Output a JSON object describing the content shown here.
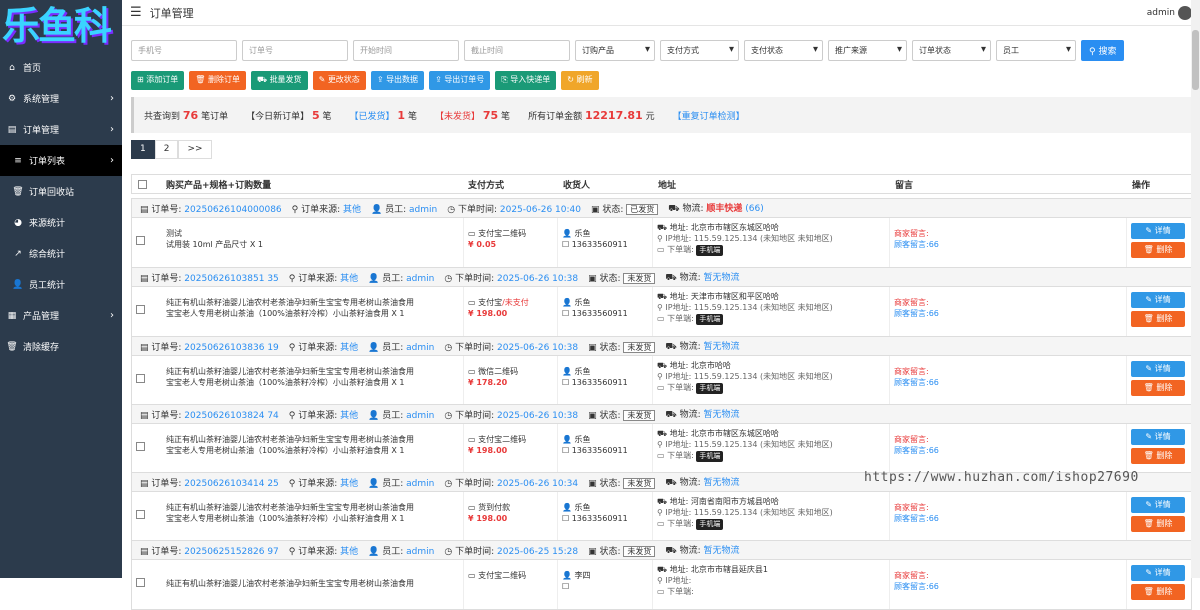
{
  "brand": {
    "logo_text": "乐鱼科"
  },
  "topbar": {
    "title": "订单管理",
    "user": "admin"
  },
  "sidebar": {
    "items": [
      {
        "label": "首页",
        "icon": "home-icon",
        "glyph": "⌂"
      },
      {
        "label": "系统管理",
        "icon": "gear-icon",
        "glyph": "⚙"
      },
      {
        "label": "订单管理",
        "icon": "table-icon",
        "glyph": "▤"
      },
      {
        "label": "订单列表",
        "icon": "list-icon",
        "glyph": "≡"
      },
      {
        "label": "订单回收站",
        "icon": "trash-icon",
        "glyph": "🗑"
      },
      {
        "label": "来源统计",
        "icon": "pie-icon",
        "glyph": "◕"
      },
      {
        "label": "综合统计",
        "icon": "line-chart-icon",
        "glyph": "↗"
      },
      {
        "label": "员工统计",
        "icon": "user-icon",
        "glyph": "👤"
      },
      {
        "label": "产品管理",
        "icon": "grid-icon",
        "glyph": "▦"
      },
      {
        "label": "清除缓存",
        "icon": "trash-icon",
        "glyph": "🗑"
      }
    ]
  },
  "filters": {
    "phone": "手机号",
    "order_no": "订单号",
    "start": "开始时间",
    "end": "截止时间",
    "selects": [
      "订购产品",
      "支付方式",
      "支付状态",
      "推广来源",
      "订单状态",
      "员工"
    ],
    "search": "搜索"
  },
  "actions": [
    "添加订单",
    "删除订单",
    "批量发货",
    "更改状态",
    "导出数据",
    "导出订单号",
    "导入快递单",
    "刷新"
  ],
  "summary": {
    "total_label": "共查询到",
    "total": "76",
    "total_unit": "笔订单",
    "today_label": "【今日新订单】",
    "today": "5",
    "today_unit": "笔",
    "shipped_label": "【已发货】",
    "shipped": "1",
    "shipped_unit": "笔",
    "unshipped_label": "【未发货】",
    "unshipped": "75",
    "unshipped_unit": "笔",
    "amount_label": "所有订单金额",
    "amount": "12217.81",
    "amount_unit": "元",
    "dup_link": "【重复订单检测】"
  },
  "pager": [
    "1",
    "2",
    ">>"
  ],
  "table": {
    "headers": [
      "购买产品+规格+订购数量",
      "支付方式",
      "收货人",
      "地址",
      "留言",
      "操作"
    ]
  },
  "labels": {
    "order_no": "订单号:",
    "source": "订单来源:",
    "staff": "员工:",
    "time": "下单时间:",
    "status": "状态:",
    "logistics": "物流:",
    "address": "地址:",
    "ip": "IP地址:",
    "device": "下单端:",
    "detail": "详情",
    "delete": "删除",
    "msg_merchant": "商家留言:",
    "msg_customer": "顾客留言:66"
  },
  "orders": [
    {
      "no": "20250626104000086",
      "source": "其他",
      "staff": "admin",
      "time": "2025-06-26 10:40",
      "status": "已发货",
      "logistics": "顺丰快递",
      "logistics_extra": "(66)",
      "product": "测试",
      "spec": "试用装 10ml 产品尺寸 X 1",
      "spec2": "",
      "pay": "支付宝二维码",
      "pay_status": "",
      "price": "¥ 0.05",
      "name": "乐鱼",
      "phone": "13633560911",
      "address": "北京市市辖区东城区哈哈",
      "ip": "115.59.125.134 (未知地区 未知地区)",
      "device": "手机端"
    },
    {
      "no": "20250626103851 35",
      "source": "其他",
      "staff": "admin",
      "time": "2025-06-26 10:38",
      "status": "未发货",
      "logistics": "暂无物流",
      "logistics_extra": "",
      "product": "纯正有机山茶籽油婴儿油农村老茶油孕妇新生宝宝专用老树山茶油食用",
      "spec": "宝宝老人专用老树山茶油（100%油茶籽冷榨）小山茶籽油食用 X 1",
      "spec2": "",
      "pay": "支付宝",
      "pay_status": "/未支付",
      "price": "¥ 198.00",
      "name": "乐鱼",
      "phone": "13633560911",
      "address": "天津市市辖区和平区哈哈",
      "ip": "115.59.125.134 (未知地区 未知地区)",
      "device": "手机端"
    },
    {
      "no": "20250626103836 19",
      "source": "其他",
      "staff": "admin",
      "time": "2025-06-26 10:38",
      "status": "未发货",
      "logistics": "暂无物流",
      "logistics_extra": "",
      "product": "纯正有机山茶籽油婴儿油农村老茶油孕妇新生宝宝专用老树山茶油食用",
      "spec": "宝宝老人专用老树山茶油（100%油茶籽冷榨）小山茶籽油食用 X 1",
      "spec2": "",
      "pay": "微信二维码",
      "pay_status": "",
      "price": "¥ 178.20",
      "name": "乐鱼",
      "phone": "13633560911",
      "address": "北京市哈哈",
      "ip": "115.59.125.134 (未知地区 未知地区)",
      "device": "手机端"
    },
    {
      "no": "20250626103824 74",
      "source": "其他",
      "staff": "admin",
      "time": "2025-06-26 10:38",
      "status": "未发货",
      "logistics": "暂无物流",
      "logistics_extra": "",
      "product": "纯正有机山茶籽油婴儿油农村老茶油孕妇新生宝宝专用老树山茶油食用",
      "spec": "宝宝老人专用老树山茶油（100%油茶籽冷榨）小山茶籽油食用 X 1",
      "spec2": "",
      "pay": "支付宝二维码",
      "pay_status": "",
      "price": "¥ 198.00",
      "name": "乐鱼",
      "phone": "13633560911",
      "address": "北京市市辖区东城区哈哈",
      "ip": "115.59.125.134 (未知地区 未知地区)",
      "device": "手机端"
    },
    {
      "no": "20250626103414 25",
      "source": "其他",
      "staff": "admin",
      "time": "2025-06-26 10:34",
      "status": "未发货",
      "logistics": "暂无物流",
      "logistics_extra": "",
      "product": "纯正有机山茶籽油婴儿油农村老茶油孕妇新生宝宝专用老树山茶油食用",
      "spec": "宝宝老人专用老树山茶油（100%油茶籽冷榨）小山茶籽油食用 X 1",
      "spec2": "",
      "pay": "货到付款",
      "pay_status": "",
      "price": "¥ 198.00",
      "name": "乐鱼",
      "phone": "13633560911",
      "address": "河南省南阳市方城县哈哈",
      "ip": "115.59.125.134 (未知地区 未知地区)",
      "device": "手机端"
    },
    {
      "no": "20250625152826 97",
      "source": "其他",
      "staff": "admin",
      "time": "2025-06-25 15:28",
      "status": "未发货",
      "logistics": "暂无物流",
      "logistics_extra": "",
      "product": "纯正有机山茶籽油婴儿油农村老茶油孕妇新生宝宝专用老树山茶油食用",
      "spec": "",
      "spec2": "",
      "pay": "支付宝二维码",
      "pay_status": "",
      "price": "",
      "name": "李四",
      "phone": "",
      "address": "北京市市辖县延庆县1",
      "ip": "",
      "device": ""
    }
  ],
  "watermark": "https://www.huzhan.com/ishop27690"
}
